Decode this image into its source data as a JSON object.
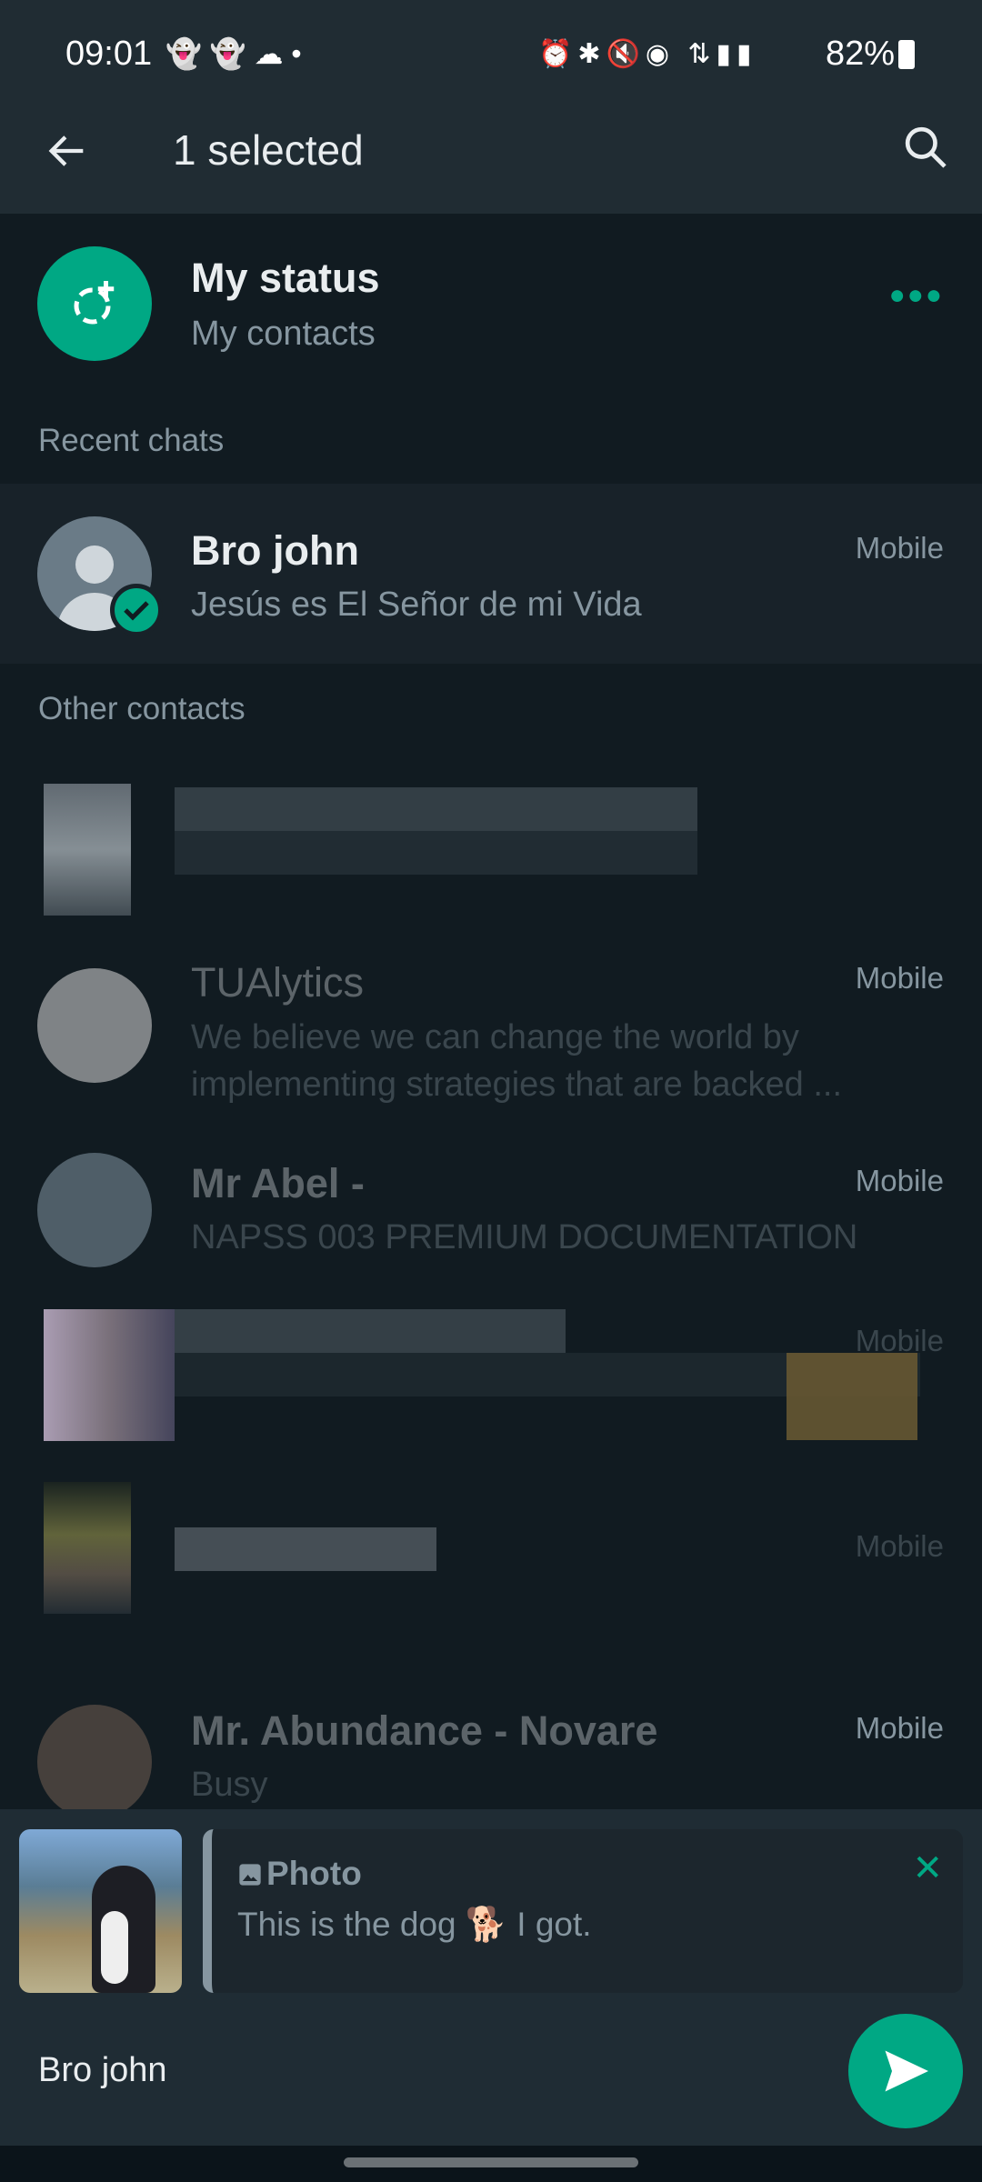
{
  "status_bar": {
    "time": "09:01",
    "battery": "82%",
    "icons": [
      "snapchat-icon",
      "snapchat-icon",
      "cloud-icon",
      "dot-icon",
      "alarm-icon",
      "bluetooth-icon",
      "mute-icon",
      "hotspot-icon",
      "4g-plus-icon",
      "signal-icon",
      "signal-icon",
      "battery-icon"
    ]
  },
  "header": {
    "title": "1 selected",
    "back_icon": "arrow-left-icon",
    "search_icon": "search-icon"
  },
  "my_status": {
    "title": "My status",
    "subtitle": "My contacts"
  },
  "sections": {
    "recent": "Recent chats",
    "other": "Other contacts"
  },
  "recent_chats": [
    {
      "name": "Bro john",
      "status": "Jesús es El Señor de mi Vida",
      "label": "Mobile",
      "selected": true
    }
  ],
  "other_contacts": [
    {
      "name": "TUAlytics",
      "status": "We believe we can change the world by implementing strategies that are backed ...",
      "label": "Mobile"
    },
    {
      "name": "Mr Abel -",
      "status": "NAPSS 003 PREMIUM DOCUMENTATION",
      "label": "Mobile"
    },
    {
      "label": "Mobile"
    },
    {
      "label": "Mobile"
    },
    {
      "name": "Mr. Abundance - Novare",
      "status": "Busy",
      "label": "Mobile"
    }
  ],
  "reply": {
    "type": "Photo",
    "caption": "This is the dog 🐕 I got."
  },
  "recipients": "Bro john",
  "colors": {
    "accent": "#00a884",
    "bg": "#111b21",
    "bar": "#202c33"
  }
}
